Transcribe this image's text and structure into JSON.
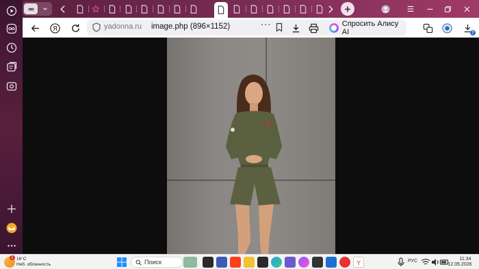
{
  "browser": {
    "address": {
      "domain": "yadonna.ru",
      "page_title": "image.php (896×1152)",
      "menu_dots": "···"
    },
    "alice_button": "Спросить Алису AI",
    "extension_badge": "7"
  },
  "image": {
    "description_icon": "photo-content"
  },
  "taskbar": {
    "weather_temp": "16°C",
    "weather_desc": "Неб. облачность",
    "weather_badge": "1",
    "search_label": "Поиск",
    "language": "РУС",
    "time": "11:34",
    "date": "12.05.2026"
  },
  "colors": {
    "accent": "#7a2c55",
    "alice_gradient": "#8a5cff",
    "yandex_red": "#fc3f1d"
  }
}
